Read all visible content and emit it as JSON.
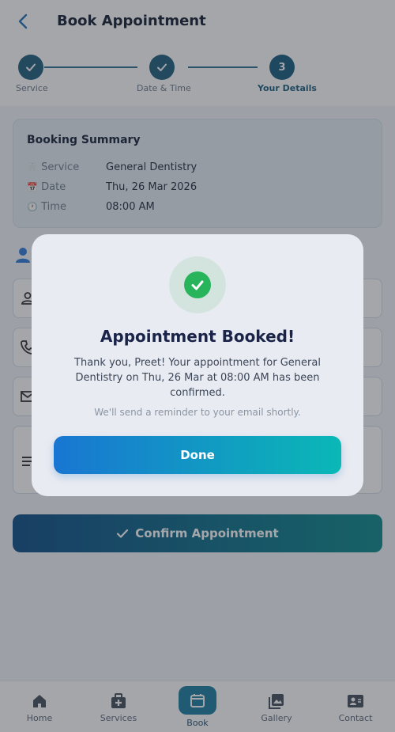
{
  "header": {
    "title": "Book Appointment"
  },
  "stepper": {
    "steps": [
      {
        "label": "Service",
        "state": "done"
      },
      {
        "label": "Date & Time",
        "state": "done"
      },
      {
        "label": "Your Details",
        "number": "3",
        "state": "active"
      }
    ]
  },
  "summary": {
    "title": "Booking Summary",
    "rows": [
      {
        "icon": "tooth-icon",
        "key": "Service",
        "value": "General Dentistry"
      },
      {
        "icon": "calendar-icon",
        "key": "Date",
        "value": "Thu, 26 Mar 2026"
      },
      {
        "icon": "clock-icon",
        "key": "Time",
        "value": "08:00 AM"
      }
    ]
  },
  "confirm": {
    "label": "Confirm Appointment"
  },
  "nav": {
    "items": [
      {
        "label": "Home",
        "icon": "home-icon"
      },
      {
        "label": "Services",
        "icon": "medical-bag-icon"
      },
      {
        "label": "Book",
        "icon": "calendar-icon",
        "active": true
      },
      {
        "label": "Gallery",
        "icon": "gallery-icon"
      },
      {
        "label": "Contact",
        "icon": "contact-card-icon"
      }
    ]
  },
  "dialog": {
    "title": "Appointment Booked!",
    "message": "Thank you, Preet! Your appointment for General Dentistry on Thu, 26 Mar at 08:00 AM has been confirmed.",
    "note": "We'll send a reminder to your email shortly.",
    "done_label": "Done"
  },
  "colors": {
    "primary": "#175e7e",
    "success": "#27b45b",
    "accent_gradient_start": "#1976d2",
    "accent_gradient_end": "#0ab8b6"
  }
}
